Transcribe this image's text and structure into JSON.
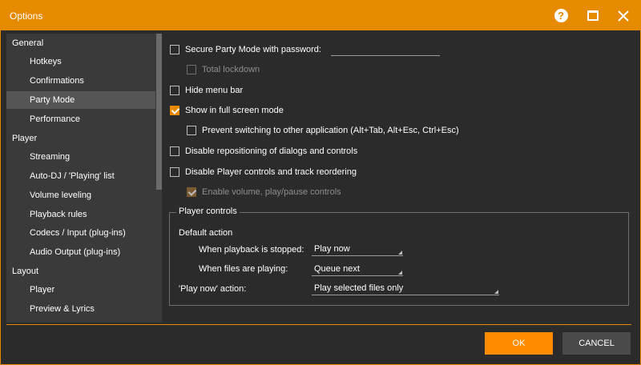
{
  "window": {
    "title": "Options",
    "accent_color": "#e68a00",
    "controls": {
      "help_icon": "?"
    }
  },
  "sidebar": {
    "items": [
      {
        "label": "General",
        "type": "category",
        "selected": false
      },
      {
        "label": "Hotkeys",
        "type": "sub",
        "selected": false
      },
      {
        "label": "Confirmations",
        "type": "sub",
        "selected": false
      },
      {
        "label": "Party Mode",
        "type": "sub",
        "selected": true
      },
      {
        "label": "Performance",
        "type": "sub",
        "selected": false
      },
      {
        "label": "Player",
        "type": "category",
        "selected": false
      },
      {
        "label": "Streaming",
        "type": "sub",
        "selected": false
      },
      {
        "label": "Auto-DJ / 'Playing' list",
        "type": "sub",
        "selected": false
      },
      {
        "label": "Volume leveling",
        "type": "sub",
        "selected": false
      },
      {
        "label": "Playback rules",
        "type": "sub",
        "selected": false
      },
      {
        "label": "Codecs / Input (plug-ins)",
        "type": "sub",
        "selected": false
      },
      {
        "label": "Audio Output (plug-ins)",
        "type": "sub",
        "selected": false
      },
      {
        "label": "Layout",
        "type": "category",
        "selected": false
      },
      {
        "label": "Player",
        "type": "sub",
        "selected": false
      },
      {
        "label": "Preview & Lyrics",
        "type": "sub",
        "selected": false
      }
    ]
  },
  "options": {
    "secure_password": {
      "label": "Secure Party Mode with password:",
      "checked": false,
      "value": ""
    },
    "total_lockdown": {
      "label": "Total lockdown",
      "checked": false,
      "enabled": false
    },
    "hide_menu_bar": {
      "label": "Hide menu bar",
      "checked": false
    },
    "full_screen": {
      "label": "Show in full screen mode",
      "checked": true
    },
    "prevent_switching": {
      "label": "Prevent switching to other application (Alt+Tab, Alt+Esc, Ctrl+Esc)",
      "checked": false
    },
    "disable_repositioning": {
      "label": "Disable repositioning of dialogs and controls",
      "checked": false
    },
    "disable_player_controls": {
      "label": "Disable Player controls and track reordering",
      "checked": false
    },
    "enable_volume": {
      "label": "Enable volume, play/pause controls",
      "checked": true,
      "enabled": false
    }
  },
  "player_controls": {
    "title": "Player controls",
    "default_action_label": "Default action",
    "stopped_label": "When playback is stopped:",
    "stopped_value": "Play now",
    "playing_label": "When files are playing:",
    "playing_value": "Queue next",
    "play_now_label": "'Play now' action:",
    "play_now_value": "Play selected files only"
  },
  "footer": {
    "ok_label": "OK",
    "cancel_label": "CANCEL"
  }
}
